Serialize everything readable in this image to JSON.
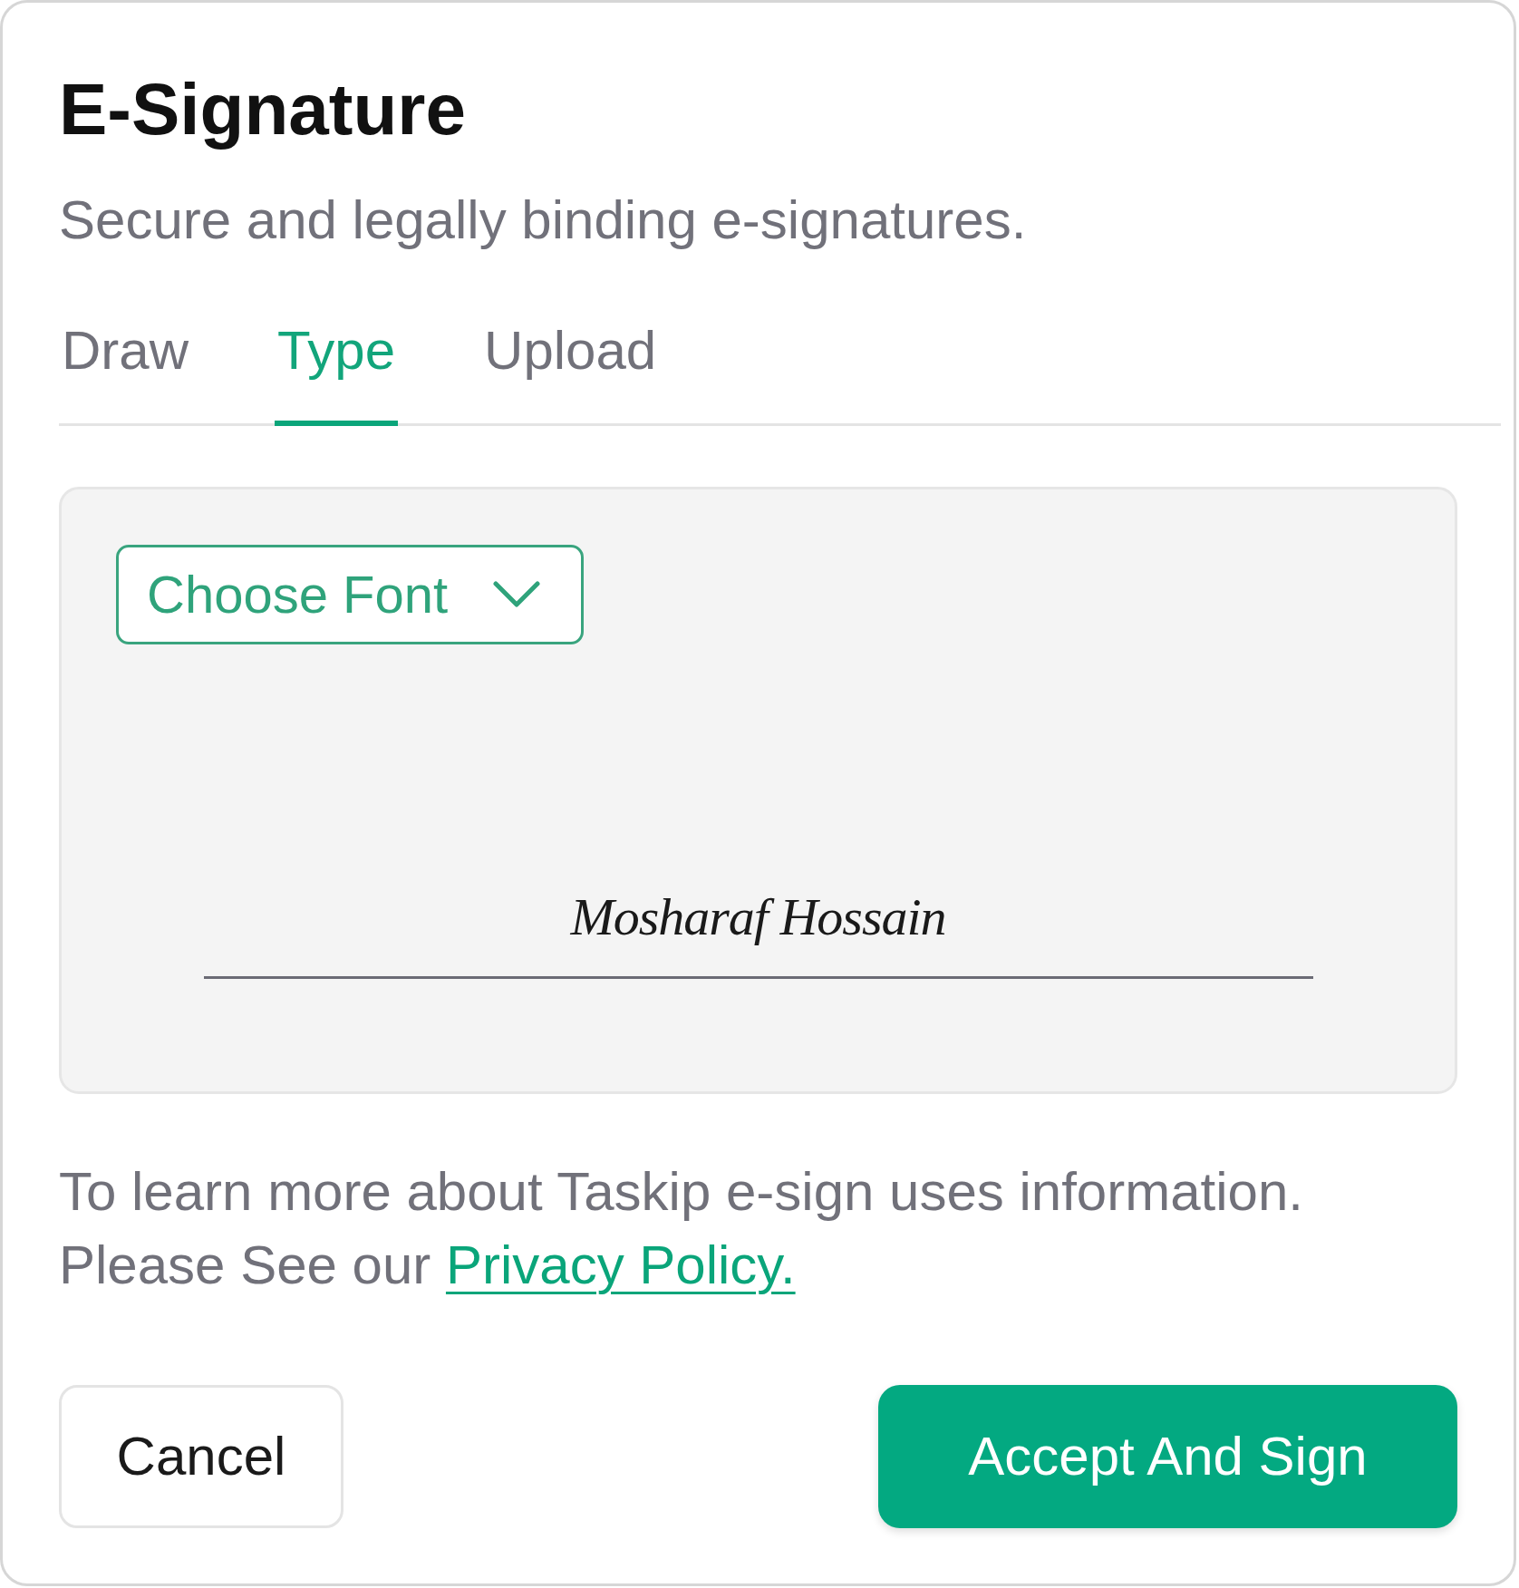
{
  "dialog": {
    "title": "E-Signature",
    "subtitle": "Secure and legally binding e-signatures.",
    "tabs": [
      {
        "label": "Draw",
        "selected": false
      },
      {
        "label": "Type",
        "selected": true
      },
      {
        "label": "Upload",
        "selected": false
      }
    ],
    "font_select": {
      "label": "Choose Font"
    },
    "signature": {
      "value": "Mosharaf Hossain"
    },
    "note": {
      "text": "To learn more about Taskip e-sign uses information. Please See our",
      "link": "Privacy Policy."
    },
    "buttons": [
      {
        "label": "Cancel",
        "kind": "outline"
      },
      {
        "label": "Accept And Sign",
        "kind": "filled"
      }
    ]
  }
}
